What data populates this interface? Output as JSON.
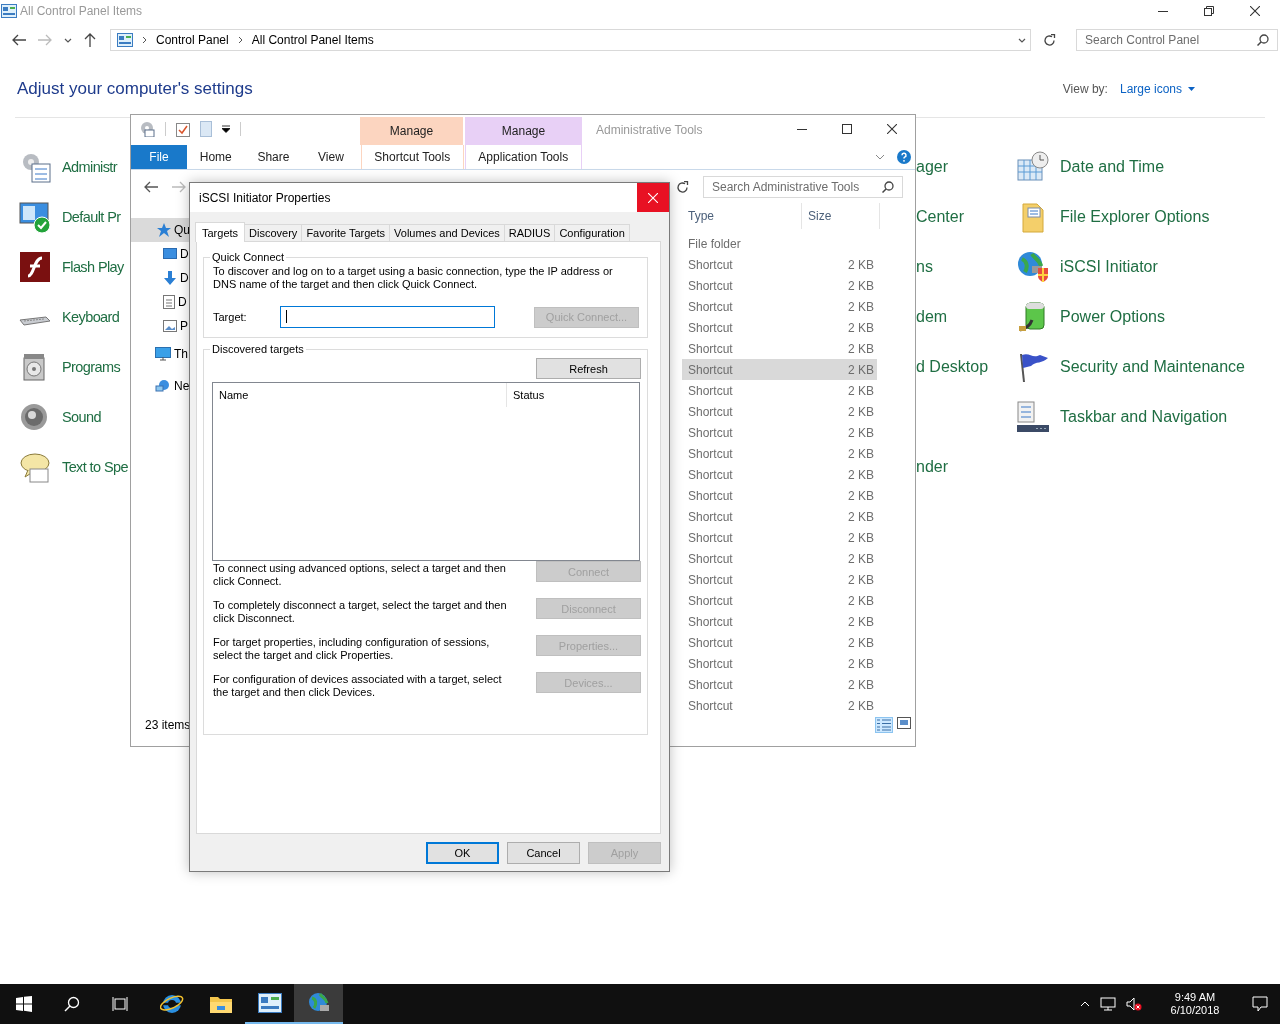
{
  "control_panel": {
    "title": "All Control Panel Items",
    "breadcrumb": [
      "Control Panel",
      "All Control Panel Items"
    ],
    "search": {
      "placeholder": "Search Control Panel"
    },
    "heading": "Adjust your computer's settings",
    "view_by": {
      "label": "View by:",
      "value": "Large icons"
    },
    "items_left": [
      "Administr",
      "Default Pr",
      "Flash Play",
      "Keyboard",
      "Programs",
      "Sound",
      "Text to Spe"
    ],
    "items_middle": [
      "ager",
      "Center",
      "ns",
      "dem",
      "d Desktop",
      "nder"
    ],
    "items_right": [
      "Date and Time",
      "File Explorer Options",
      "iSCSI Initiator",
      "Power Options",
      "Security and Maintenance",
      "Taskbar and Navigation"
    ]
  },
  "explorer": {
    "title": "Administrative Tools",
    "ribbon_tabs": [
      {
        "label": "File",
        "kind": "file"
      },
      {
        "label": "Home",
        "kind": "tab"
      },
      {
        "label": "Share",
        "kind": "tab"
      },
      {
        "label": "View",
        "kind": "tab"
      },
      {
        "label": "Shortcut Tools",
        "kind": "context",
        "header": "Manage",
        "color": "#fcd5c0"
      },
      {
        "label": "Application Tools",
        "kind": "context",
        "header": "Manage",
        "color": "#e8d0f6"
      }
    ],
    "search": {
      "placeholder": "Search Administrative Tools"
    },
    "nav_items": [
      {
        "label": "Qu",
        "selected": true
      },
      {
        "label": "D",
        "selected": false
      },
      {
        "label": "D",
        "selected": false
      },
      {
        "label": "D",
        "selected": false
      },
      {
        "label": "P",
        "selected": false
      },
      {
        "label": "Th",
        "selected": false
      },
      {
        "label": "Ne",
        "selected": false
      }
    ],
    "columns": [
      "Type",
      "Size"
    ],
    "rows": [
      {
        "type": "File folder",
        "selected": false
      },
      {
        "type": "Shortcut",
        "size": "2 KB",
        "selected": false
      },
      {
        "type": "Shortcut",
        "size": "2 KB",
        "selected": false
      },
      {
        "type": "Shortcut",
        "size": "2 KB",
        "selected": false
      },
      {
        "type": "Shortcut",
        "size": "2 KB",
        "selected": false
      },
      {
        "type": "Shortcut",
        "size": "2 KB",
        "selected": false
      },
      {
        "type": "Shortcut",
        "size": "2 KB",
        "selected": true
      },
      {
        "type": "Shortcut",
        "size": "2 KB",
        "selected": false
      },
      {
        "type": "Shortcut",
        "size": "2 KB",
        "selected": false
      },
      {
        "type": "Shortcut",
        "size": "2 KB",
        "selected": false
      },
      {
        "type": "Shortcut",
        "size": "2 KB",
        "selected": false
      },
      {
        "type": "Shortcut",
        "size": "2 KB",
        "selected": false
      },
      {
        "type": "Shortcut",
        "size": "2 KB",
        "selected": false
      },
      {
        "type": "Shortcut",
        "size": "2 KB",
        "selected": false
      },
      {
        "type": "Shortcut",
        "size": "2 KB",
        "selected": false
      },
      {
        "type": "Shortcut",
        "size": "2 KB",
        "selected": false
      },
      {
        "type": "Shortcut",
        "size": "2 KB",
        "selected": false
      },
      {
        "type": "Shortcut",
        "size": "2 KB",
        "selected": false
      },
      {
        "type": "Shortcut",
        "size": "2 KB",
        "selected": false
      },
      {
        "type": "Shortcut",
        "size": "2 KB",
        "selected": false
      },
      {
        "type": "Shortcut",
        "size": "2 KB",
        "selected": false
      },
      {
        "type": "Shortcut",
        "size": "2 KB",
        "selected": false
      },
      {
        "type": "Shortcut",
        "size": "2 KB",
        "selected": false
      }
    ],
    "status": "23 items"
  },
  "dialog": {
    "title": "iSCSI Initiator Properties",
    "tabs": [
      {
        "label": "Targets",
        "selected": true
      },
      {
        "label": "Discovery",
        "selected": false
      },
      {
        "label": "Favorite Targets",
        "selected": false
      },
      {
        "label": "Volumes and Devices",
        "selected": false
      },
      {
        "label": "RADIUS",
        "selected": false
      },
      {
        "label": "Configuration",
        "selected": false
      }
    ],
    "quick_connect": {
      "legend": "Quick Connect",
      "description": "To discover and log on to a target using a basic connection, type the IP address or DNS name of the target and then click Quick Connect.",
      "target_label": "Target:",
      "focused": true,
      "button": {
        "label": "Quick Connect...",
        "disabled": true
      }
    },
    "discovered": {
      "legend": "Discovered targets",
      "refresh": {
        "label": "Refresh",
        "disabled": false
      },
      "columns": [
        "Name",
        "Status"
      ]
    },
    "actions": [
      {
        "text": "To connect using advanced options, select a target and then click Connect.",
        "button": {
          "label": "Connect",
          "disabled": true
        }
      },
      {
        "text": "To completely disconnect a target, select the target and then click Disconnect.",
        "button": {
          "label": "Disconnect",
          "disabled": true
        }
      },
      {
        "text": "For target properties, including configuration of sessions, select the target and click Properties.",
        "button": {
          "label": "Properties...",
          "disabled": true
        }
      },
      {
        "text": "For configuration of devices associated with a target, select the target and then click Devices.",
        "button": {
          "label": "Devices...",
          "disabled": true
        }
      }
    ],
    "buttons": [
      {
        "label": "OK",
        "default": true,
        "disabled": false
      },
      {
        "label": "Cancel",
        "default": false,
        "disabled": false
      },
      {
        "label": "Apply",
        "default": false,
        "disabled": true
      }
    ]
  },
  "taskbar": {
    "apps": [
      {
        "running": false,
        "selected": false
      },
      {
        "running": false,
        "selected": false
      },
      {
        "running": true,
        "selected": false
      },
      {
        "running": true,
        "selected": true
      }
    ],
    "time": "9:49 AM",
    "date": "6/10/2018"
  }
}
